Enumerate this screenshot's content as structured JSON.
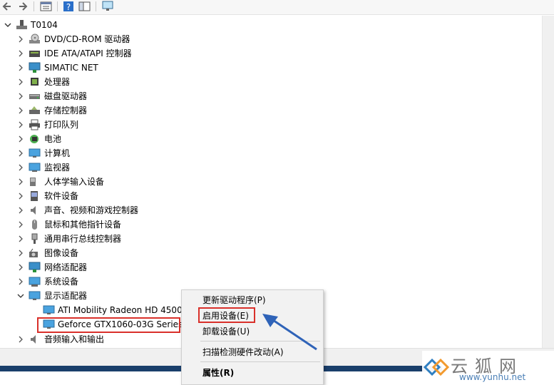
{
  "toolbar": {
    "buttons": [
      "back-arrow-icon",
      "forward-arrow-icon",
      "properties-icon",
      "help-icon",
      "panel-icon",
      "scan-monitor-icon"
    ]
  },
  "tree": {
    "root": "T0104",
    "items": [
      {
        "label": "DVD/CD-ROM 驱动器",
        "icon": "dvd-drive-icon"
      },
      {
        "label": "IDE ATA/ATAPI 控制器",
        "icon": "ide-controller-icon"
      },
      {
        "label": "SIMATIC NET",
        "icon": "network-icon"
      },
      {
        "label": "处理器",
        "icon": "processor-icon"
      },
      {
        "label": "磁盘驱动器",
        "icon": "disk-drive-icon"
      },
      {
        "label": "存储控制器",
        "icon": "storage-controller-icon"
      },
      {
        "label": "打印队列",
        "icon": "printer-icon"
      },
      {
        "label": "电池",
        "icon": "battery-icon"
      },
      {
        "label": "计算机",
        "icon": "computer-icon"
      },
      {
        "label": "监视器",
        "icon": "monitor-icon"
      },
      {
        "label": "人体学输入设备",
        "icon": "hid-icon"
      },
      {
        "label": "软件设备",
        "icon": "software-device-icon"
      },
      {
        "label": "声音、视频和游戏控制器",
        "icon": "speaker-icon"
      },
      {
        "label": "鼠标和其他指针设备",
        "icon": "mouse-icon"
      },
      {
        "label": "通用串行总线控制器",
        "icon": "usb-icon"
      },
      {
        "label": "图像设备",
        "icon": "camera-icon"
      },
      {
        "label": "网络适配器",
        "icon": "network-adapter-icon"
      },
      {
        "label": "系统设备",
        "icon": "system-device-icon"
      },
      {
        "label": "显示适配器",
        "icon": "display-adapter-icon"
      }
    ],
    "display_children": [
      {
        "label": "ATI Mobility Radeon HD 4500",
        "icon": "display-card-icon"
      },
      {
        "label": "Geforce GTX1060-03G Series",
        "icon": "display-card-icon"
      }
    ],
    "after": {
      "label": "音频输入和输出",
      "icon": "audio-io-icon"
    }
  },
  "context_menu": {
    "items": [
      {
        "label": "更新驱动程序(P)"
      },
      {
        "label": "启用设备(E)"
      },
      {
        "label": "卸载设备(U)"
      },
      {
        "label": "扫描检测硬件改动(A)"
      },
      {
        "label": "属性(R)"
      }
    ]
  },
  "colors": {
    "highlight": "#d9302a",
    "arrow": "#2f63b8",
    "scroll_thumb": "#1a3f6b"
  },
  "watermark": {
    "brand": "云狐网",
    "url": "www.yunhu.net"
  }
}
